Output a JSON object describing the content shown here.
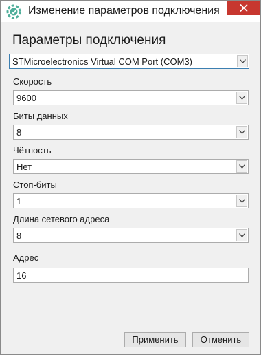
{
  "window": {
    "title": "Изменение параметров подключения",
    "close_glyph": "close-icon",
    "app_icon": "gear-link-icon",
    "colors": {
      "close": "#c7372f",
      "icon": "#4fae9a"
    }
  },
  "form": {
    "heading": "Параметры подключения",
    "port": {
      "value": "STMicroelectronics Virtual COM Port (COM3)"
    },
    "speed": {
      "label": "Скорость",
      "value": "9600"
    },
    "data_bits": {
      "label": "Биты данных",
      "value": "8"
    },
    "parity": {
      "label": "Чётность",
      "value": "Нет"
    },
    "stop_bits": {
      "label": "Стоп-биты",
      "value": "1"
    },
    "address_length": {
      "label": "Длина сетевого адреса",
      "value": "8"
    },
    "address": {
      "label": "Адрес",
      "value": "16"
    }
  },
  "buttons": {
    "apply": "Применить",
    "cancel": "Отменить"
  }
}
